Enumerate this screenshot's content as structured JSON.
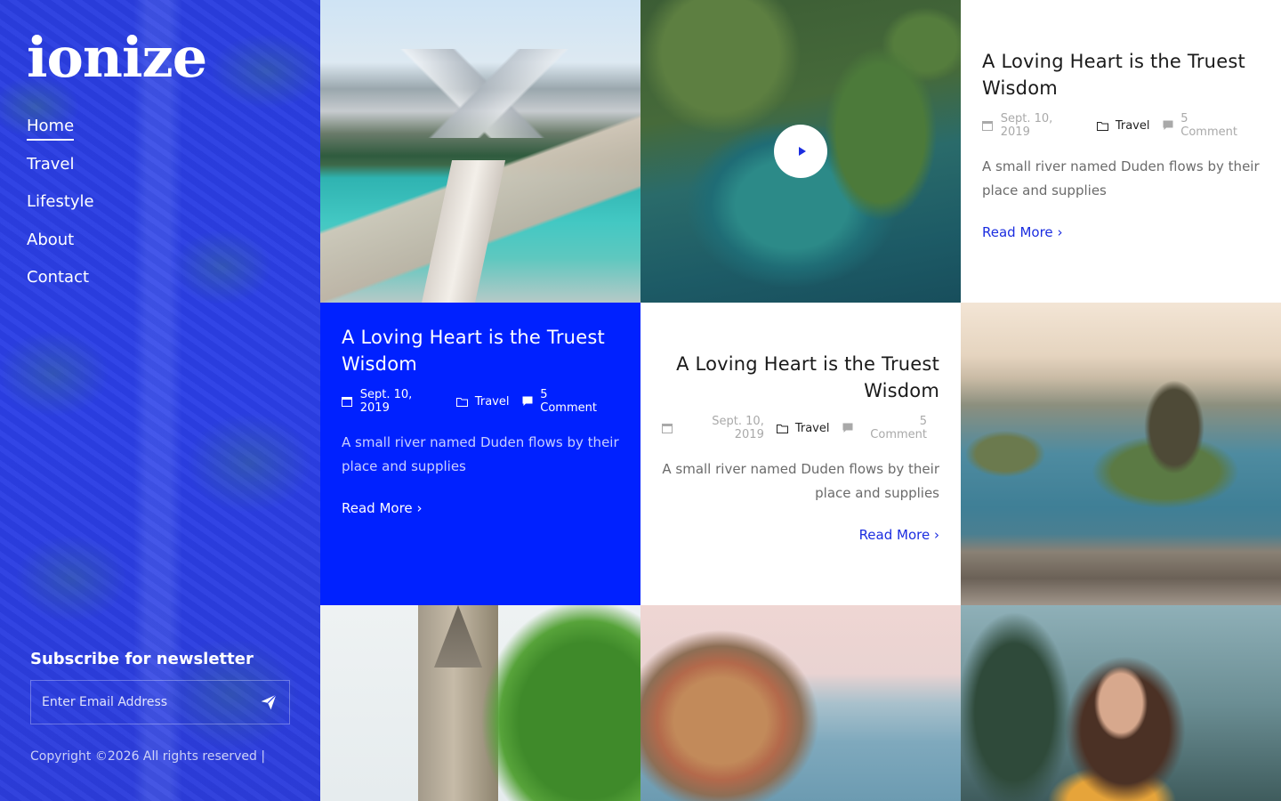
{
  "brand": {
    "logo": "ionize"
  },
  "nav": [
    {
      "label": "Home",
      "active": true
    },
    {
      "label": "Travel"
    },
    {
      "label": "Lifestyle"
    },
    {
      "label": "About"
    },
    {
      "label": "Contact"
    }
  ],
  "newsletter": {
    "heading": "Subscribe for newsletter",
    "placeholder": "Enter Email Address",
    "icon": "send-icon"
  },
  "footer": {
    "copyright": "Copyright ©2026 All rights reserved |"
  },
  "posts": [
    {
      "title": "A Loving Heart is the Truest Wisdom",
      "date": "Sept. 10, 2019",
      "category": "Travel",
      "comments": "5 Comment",
      "excerpt": "A small river named Duden flows by their place and supplies",
      "read_more": "Read More"
    },
    {
      "title": "A Loving Heart is the Truest Wisdom",
      "date": "Sept. 10, 2019",
      "category": "Travel",
      "comments": "5 Comment",
      "excerpt": "A small river named Duden flows by their place and supplies",
      "read_more": "Read More"
    },
    {
      "title": "A Loving Heart is the Truest Wisdom",
      "date": "Sept. 10, 2019",
      "category": "Travel",
      "comments": "5 Comment",
      "excerpt": "A small river named Duden flows by their place and supplies",
      "read_more": "Read More"
    }
  ],
  "colors": {
    "accent": "#0021ff",
    "sidebar": "#2b3fe6",
    "link": "#1b2de0"
  }
}
